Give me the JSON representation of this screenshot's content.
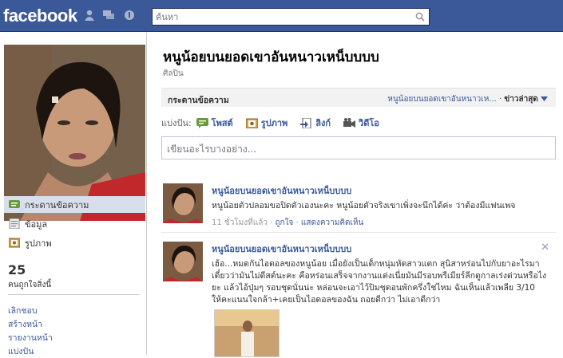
{
  "header": {
    "logo": "facebook",
    "search_placeholder": "ค้นหา"
  },
  "colors": {
    "brand": "#3b5998",
    "bar": "#f2f2f2",
    "link": "#3b5998"
  },
  "sidebar": {
    "items": [
      {
        "label": "กระดานข้อความ",
        "icon": "wall-icon",
        "active": true
      },
      {
        "label": "ข้อมูล",
        "icon": "info-icon",
        "active": false
      },
      {
        "label": "รูปภาพ",
        "icon": "photos-icon",
        "active": false
      }
    ],
    "likes_count": "25",
    "likes_label": "คนถูกใจสิ่งนี้",
    "links": [
      "เลิกชอบ",
      "สร้างหน้า",
      "รายงานหน้า",
      "แบ่งปัน"
    ]
  },
  "page": {
    "title": "หนูน้อยบนยอดเขาอันหนาวเหน็บบบบ",
    "category": "ศิลปิน"
  },
  "wall": {
    "title": "กระดานข้อความ",
    "filter_link": "หนูน้อยบนยอดเขาอันหนาวเห...",
    "filter_sep": " · ",
    "filter_current": "ข่าวล่าสุด",
    "share_label": "แบ่งปัน:",
    "share_items": [
      {
        "label": "โพสต์",
        "icon": "status-icon"
      },
      {
        "label": "รูปภาพ",
        "icon": "photo-icon"
      },
      {
        "label": "ลิงก์",
        "icon": "link-icon"
      },
      {
        "label": "วิดีโอ",
        "icon": "video-icon"
      }
    ],
    "composer_placeholder": "เขียนอะไรบางอย่าง..."
  },
  "posts": [
    {
      "author": "หนูน้อยบนยอดเขาอันหนาวเหน็บบบบ",
      "text": "หนูน้อยตัวปลอมขอปิดตัวเองนะคะ หนูน้อยตัวจริงเขาเพิ่งจะนึกได้ค่ะ ว่าต้องมีแฟนเพจ",
      "time": "11 ชั่วโมงที่แล้ว",
      "like": "ถูกใจ",
      "comment": "แสดงความคิดเห็น"
    },
    {
      "author": "หนูน้อยบนยอดเขาอันหนาวเหน็บบบบ",
      "text": "เฮ้อ...หมดกันไอดอลของหนูน้อย เมื่อยังเป็นเด็กหนุ่มหัดสาวแตก สุนิสาหร่อนไปกับยาอะไรมา เดี๋ยวว่ามันไม่ดีสต์นะคะ คือหร่อนเสร็จจากงานแต่งเนี่ยมันมีรอบพรีเมียร์ลีกดูกาลเร่งด่วนหรือไงยะ แล้วไอ้ปุ่มๆ รอบชุดนั่นน่ะ หล่อนจะเอาไว้ปิมชุดอนพักครึ่งใช่ไหม ฉันเห็นแล้วเพลีย 3/10 ให้คะแนนใจกล้า+เคยเป็นไอดอลของฉัน ถอยดีกว่า ไม่เอาดีกว่า",
      "close": "✕"
    }
  ]
}
